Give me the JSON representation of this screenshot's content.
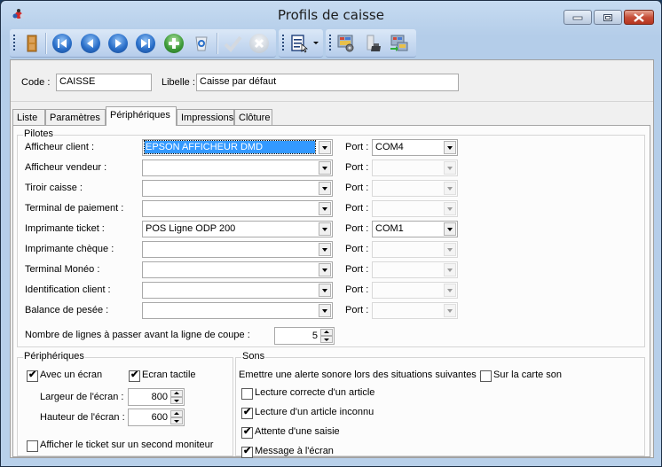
{
  "window": {
    "title": "Profils de caisse",
    "controls": {
      "minimize": "minimize",
      "maximize": "maximize",
      "close": "close"
    }
  },
  "toolbar": {
    "main": [
      {
        "name": "exit-door-icon",
        "label": "Quitter",
        "enabled": true
      },
      {
        "name": "first-record-icon",
        "glyph": "⏮",
        "enabled": true
      },
      {
        "name": "previous-record-icon",
        "glyph": "◀",
        "enabled": true
      },
      {
        "name": "next-record-icon",
        "glyph": "▶",
        "enabled": true
      },
      {
        "name": "last-record-icon",
        "glyph": "⏭",
        "enabled": true
      },
      {
        "name": "add-record-icon",
        "glyph": "+",
        "enabled": true
      },
      {
        "name": "delete-recycle-bin-icon",
        "glyph": "♻",
        "enabled": true
      },
      {
        "name": "validate-check-icon",
        "glyph": "✔",
        "enabled": false
      },
      {
        "name": "cancel-x-icon",
        "glyph": "✕",
        "enabled": false
      }
    ],
    "report": {
      "name": "report-document-icon",
      "dropdown": "▾"
    },
    "extra": [
      {
        "name": "workstation-settings-icon"
      },
      {
        "name": "cash-register-icon"
      },
      {
        "name": "workstation-transfer-icon"
      }
    ]
  },
  "header": {
    "code_label": "Code :",
    "code_value": "CAISSE",
    "libelle_label": "Libelle :",
    "libelle_value": "Caisse par défaut"
  },
  "tabs": [
    {
      "label": "Liste",
      "active": false
    },
    {
      "label": "Paramètres",
      "active": false
    },
    {
      "label": "Périphériques",
      "active": true
    },
    {
      "label": "Impressions",
      "active": false
    },
    {
      "label": "Clôture",
      "active": false
    }
  ],
  "pilotes": {
    "title": "Pilotes",
    "port_label": "Port :",
    "rows": [
      {
        "label": "Afficheur client :",
        "value": "EPSON AFFICHEUR DMD",
        "selected": true,
        "port": "COM4",
        "port_enabled": true
      },
      {
        "label": "Afficheur vendeur :",
        "value": "",
        "port": "",
        "port_enabled": false
      },
      {
        "label": "Tiroir caisse :",
        "value": "",
        "port": "",
        "port_enabled": false
      },
      {
        "label": "Terminal de paiement :",
        "value": "",
        "port": "",
        "port_enabled": false
      },
      {
        "label": "Imprimante ticket :",
        "value": "POS Ligne ODP 200",
        "port": "COM1",
        "port_enabled": true
      },
      {
        "label": "Imprimante chèque :",
        "value": "",
        "port": "",
        "port_enabled": false
      },
      {
        "label": "Terminal Monéo :",
        "value": "",
        "port": "",
        "port_enabled": false
      },
      {
        "label": "Identification client :",
        "value": "",
        "port": "",
        "port_enabled": false
      },
      {
        "label": "Balance de pesée :",
        "value": "",
        "port": "",
        "port_enabled": false
      }
    ],
    "lines_label": "Nombre de lignes à passer avant la ligne de coupe :",
    "lines_value": "5"
  },
  "peripheriques": {
    "title": "Périphériques",
    "avec_ecran": {
      "label": "Avec un écran",
      "checked": true
    },
    "ecran_tactile": {
      "label": "Ecran tactile",
      "checked": true
    },
    "largeur_label": "Largeur de l'écran :",
    "largeur_value": "800",
    "hauteur_label": "Hauteur de l'écran :",
    "hauteur_value": "600",
    "second_moniteur": {
      "label": "Afficher le ticket sur un second moniteur",
      "checked": false
    }
  },
  "sons": {
    "title": "Sons",
    "alert_label": "Emettre une alerte sonore lors des situations suivantes :",
    "carte_son": {
      "label": "Sur la carte son",
      "checked": false
    },
    "options": [
      {
        "label": "Lecture correcte d'un article",
        "checked": false
      },
      {
        "label": "Lecture d'un article inconnu",
        "checked": true
      },
      {
        "label": "Attente d'une saisie",
        "checked": true
      },
      {
        "label": "Message à l'écran",
        "checked": true
      }
    ]
  }
}
